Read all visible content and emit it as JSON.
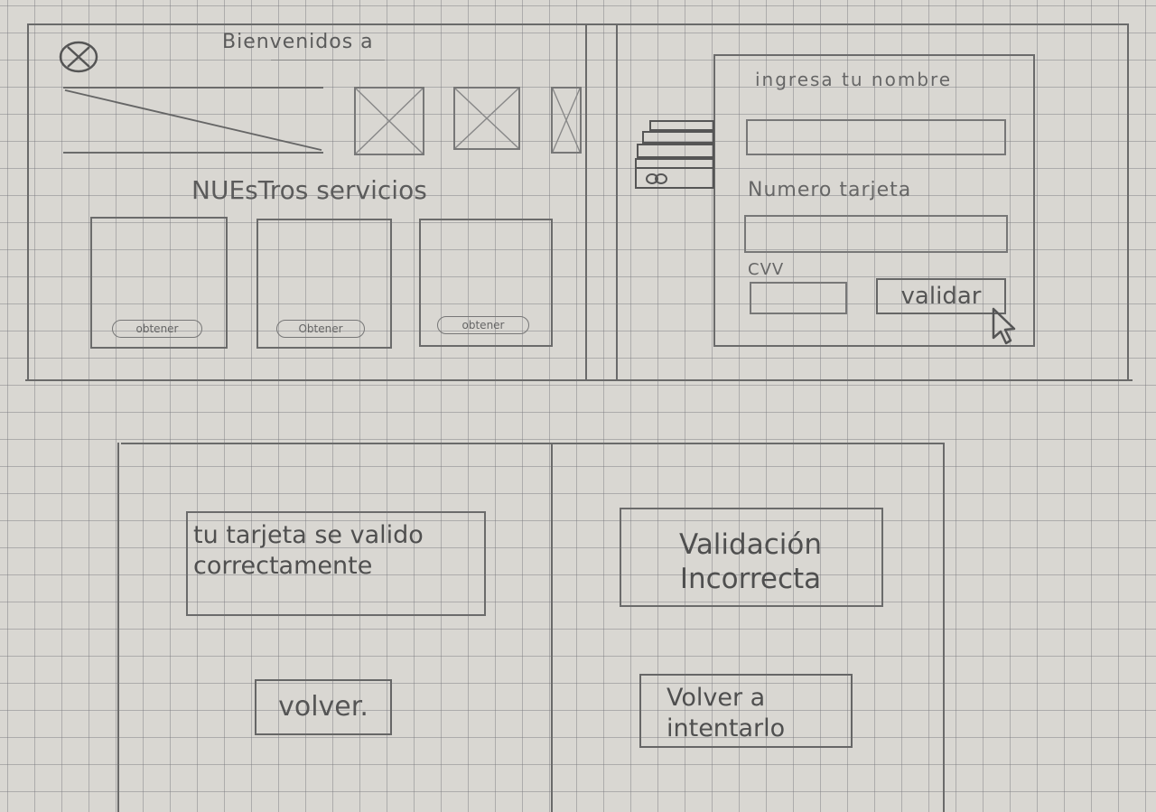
{
  "screen1": {
    "welcome": "Bienvenidos a",
    "services_heading": "NUEsTros servicios",
    "service_buttons": [
      "obtener",
      "Obtener",
      "obtener"
    ],
    "icons": {
      "logo": "circle-x-icon",
      "hero": "image-placeholder",
      "thumbs": "image-placeholder"
    }
  },
  "screen2": {
    "name_label": "ingresa tu nombre",
    "card_label": "Numero tarjeta",
    "cvv_label": "CVV",
    "validate_button": "validar",
    "icons": {
      "card": "credit-card-icon",
      "cursor": "cursor-arrow-icon"
    }
  },
  "screen3": {
    "success_message": "tu tarjeta se valido correctamente",
    "back_button": "volver."
  },
  "screen4": {
    "error_message": "Validación Incorrecta",
    "retry_button": "Volver a intentarlo"
  }
}
